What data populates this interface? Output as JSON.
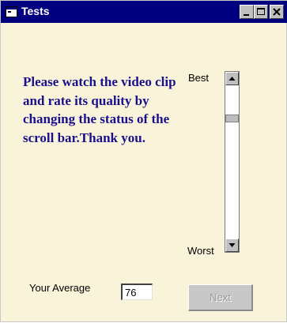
{
  "window": {
    "title": "Tests",
    "icons": {
      "app": "app-window-icon",
      "minimize": "minimize-icon",
      "maximize": "maximize-icon",
      "close": "close-icon"
    }
  },
  "main": {
    "instructions": "Please watch the video clip and rate its quality by changing the status of the scroll bar.Thank you.",
    "instructions_color": "#1a0f8c",
    "rating": {
      "top_label": "Best",
      "bottom_label": "Worst",
      "thumb_position": 0.2,
      "up_arrow_icon": "scroll-up-arrow-icon",
      "down_arrow_icon": "scroll-down-arrow-icon"
    },
    "average": {
      "label": "Your Average",
      "value": "76"
    },
    "next_button": {
      "label": "Next",
      "enabled": false
    }
  },
  "colors": {
    "titlebar": "#00007f",
    "window_background": "#f9f4d9"
  }
}
